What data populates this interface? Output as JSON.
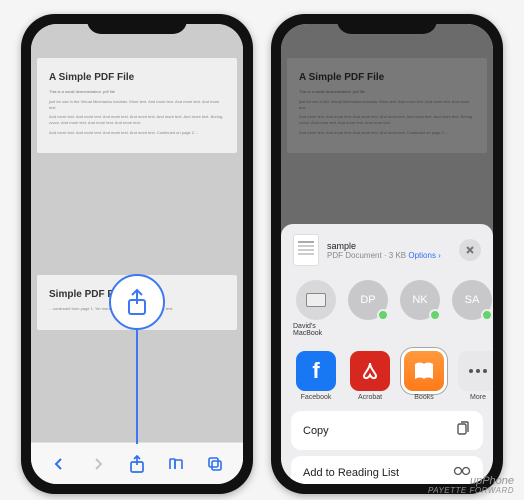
{
  "watermark": {
    "line1": "upPhone",
    "line2": "PAYETTE FORWARD"
  },
  "pdf": {
    "title1": "A Simple PDF File",
    "sub": "This is a small demonstration .pdf file",
    "p1": "just for use in the Virtual Mechanics tutorials. More text. And more text. And more text. And more text.",
    "p2": "And more text. And more text. And more text. And more text. And more text. And more text. Boring, zzzzz. And more text. And more text. And more text.",
    "p3": "And more text. And more text. And more text. And more text. Continued on page 2…",
    "title2": "Simple PDF File 2",
    "p4": "…continued from page 1. Yet more text. And more text. And more text."
  },
  "share_sheet": {
    "doc_name": "sample",
    "doc_type": "PDF Document",
    "doc_size": "3 KB",
    "options": "Options",
    "contacts": [
      {
        "label": "David's MacBook",
        "initials": ""
      },
      {
        "label": "",
        "initials": "DP"
      },
      {
        "label": "",
        "initials": "NK"
      },
      {
        "label": "",
        "initials": "SA"
      }
    ],
    "apps": {
      "facebook": "Facebook",
      "acrobat": "Acrobat",
      "books": "Books",
      "more": "More"
    },
    "actions": {
      "copy": "Copy",
      "reading_list": "Add to Reading List"
    }
  }
}
